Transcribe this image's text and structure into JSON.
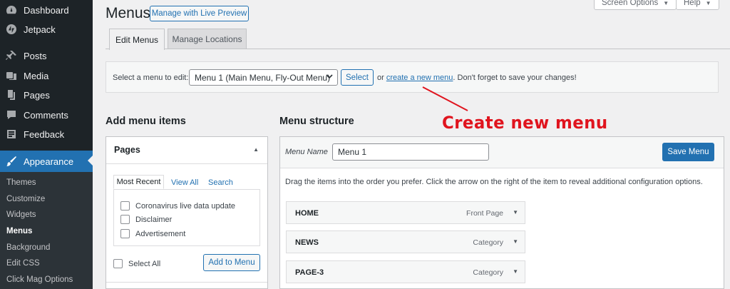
{
  "sidebar": {
    "items": [
      {
        "label": "Dashboard",
        "icon": "dashboard-icon"
      },
      {
        "label": "Jetpack",
        "icon": "jetpack-icon"
      },
      {
        "label": "Posts",
        "icon": "pin-icon"
      },
      {
        "label": "Media",
        "icon": "media-icon"
      },
      {
        "label": "Pages",
        "icon": "pages-icon"
      },
      {
        "label": "Comments",
        "icon": "comments-icon"
      },
      {
        "label": "Feedback",
        "icon": "feedback-icon"
      },
      {
        "label": "Appearance",
        "icon": "brush-icon",
        "active": true
      }
    ],
    "submenu": [
      "Themes",
      "Customize",
      "Widgets",
      "Menus",
      "Background",
      "Edit CSS",
      "Click Mag Options"
    ],
    "current_submenu": "Menus"
  },
  "header": {
    "title": "Menus",
    "live_preview_button": "Manage with Live Preview",
    "screen_options": "Screen Options",
    "help": "Help"
  },
  "tabs": {
    "edit": "Edit Menus",
    "locations": "Manage Locations"
  },
  "select_bar": {
    "label": "Select a menu to edit:",
    "selected_menu": "Menu 1 (Main Menu, Fly-Out Menu)",
    "select_button": "Select",
    "or_text": "or",
    "create_link": "create a new menu",
    "save_reminder": ". Don't forget to save your changes!"
  },
  "annotation": {
    "text": "Create new menu",
    "color": "#e0141e"
  },
  "add_items": {
    "heading": "Add menu items",
    "section": "Pages",
    "tabs": [
      "Most Recent",
      "View All",
      "Search"
    ],
    "pages": [
      "Coronavirus live data update",
      "Disclaimer",
      "Advertisement"
    ],
    "select_all": "Select All",
    "add_button": "Add to Menu"
  },
  "structure": {
    "heading": "Menu structure",
    "name_label": "Menu Name",
    "name_value": "Menu 1",
    "save_button": "Save Menu",
    "instructions": "Drag the items into the order you prefer. Click the arrow on the right of the item to reveal additional configuration options.",
    "items": [
      {
        "title": "HOME",
        "type": "Front Page"
      },
      {
        "title": "NEWS",
        "type": "Category"
      },
      {
        "title": "PAGE-3",
        "type": "Category"
      }
    ]
  },
  "colors": {
    "sidebar_bg": "#1d2327",
    "accent": "#2271b1",
    "annotation": "#e0141e"
  }
}
